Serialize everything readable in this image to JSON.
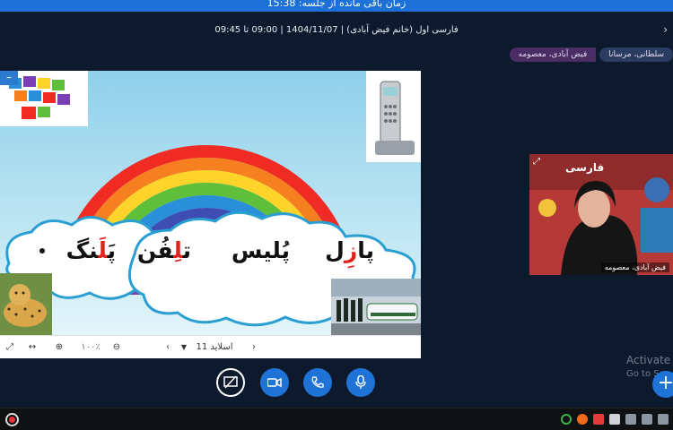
{
  "session": {
    "timer_text": "زمان باقی مانده از جلسه: 15:38",
    "class_info": "فارسی اول (خانم فیض آبادی) | 1404/11/07 | 09:00 تا 09:45"
  },
  "participants": [
    "فیض آبادی، معصومه",
    "سلطانی، مرسانا"
  ],
  "slide": {
    "words": [
      {
        "pre": "پا",
        "hl": "زِ",
        "post": "ل"
      },
      {
        "pre": "پُ",
        "hl": "",
        "post": "لیس"
      },
      {
        "pre": "ت",
        "hl": "لِ",
        "post": "فُن"
      },
      {
        "pre": "پَ",
        "hl": "لَ",
        "post": "نگ"
      }
    ],
    "toolbar": {
      "zoom_label": "۱۰۰٪",
      "slide_label": "اسلاید 11"
    }
  },
  "video": {
    "name_label": "فیض آبادی، معصومه",
    "poster_text": "فارسی"
  },
  "watermark": {
    "activate": "Activate",
    "goto": "Go to Se"
  },
  "colors": {
    "accent": "#1f73d6",
    "chip_purple": "#4a2d64",
    "chip_blue": "#2a3d61",
    "highlight_red": "#e0211c"
  }
}
